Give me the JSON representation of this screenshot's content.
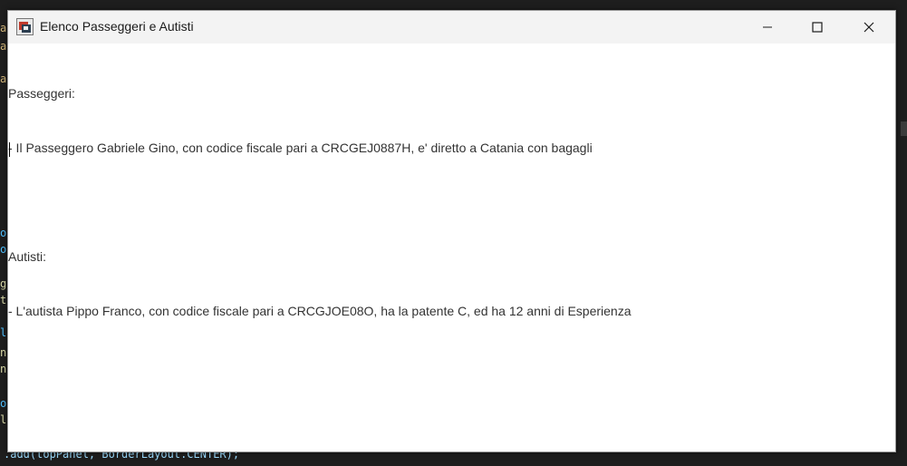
{
  "window": {
    "title": "Elenco Passeggeri e Autisti",
    "buttons": {
      "minimize": "minimize",
      "maximize": "maximize",
      "close": "close"
    }
  },
  "content": {
    "lines": [
      "Passeggeri:",
      "- Il Passeggero Gabriele Gino, con codice fiscale pari a CRCGEJ0887H, e' diretto a Catania con bagagli",
      "",
      "Autisti:",
      "- L'autista Pippo Franco, con codice fiscale pari a CRCGJOE08O, ha la patente C, ed ha 12 anni di Esperienza"
    ]
  },
  "background": {
    "code_snippet": ".add(topPanel, BorderLayout.CENTER);"
  },
  "colors": {
    "editor_bg": "#1e1e1e",
    "titlebar_bg": "#f3f3f3",
    "text": "#333333"
  }
}
